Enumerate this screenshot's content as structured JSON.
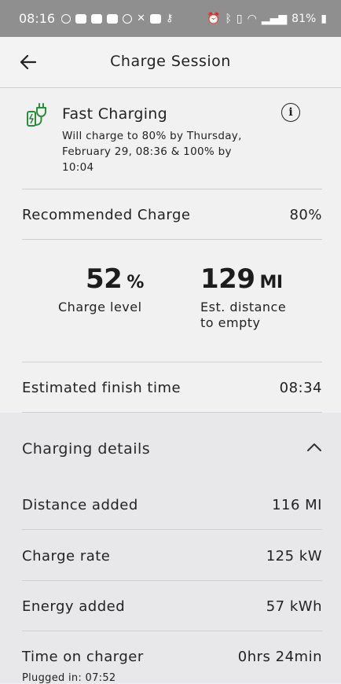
{
  "status_bar": {
    "time": "08:16",
    "battery": "81%"
  },
  "header": {
    "title": "Charge Session"
  },
  "fast_charging": {
    "title": "Fast Charging",
    "description": "Will charge to 80% by Thursday, February 29, 08:36 & 100% by 10:04"
  },
  "recommended": {
    "label": "Recommended Charge",
    "value": "80%"
  },
  "stats": {
    "charge_level": {
      "value": "52",
      "unit": "%",
      "label": "Charge level"
    },
    "distance": {
      "value": "129",
      "unit": "MI",
      "label": "Est. distance to empty"
    }
  },
  "finish_time": {
    "label": "Estimated finish time",
    "value": "08:34"
  },
  "details": {
    "title": "Charging details",
    "rows": [
      {
        "label": "Distance added",
        "value": "116 MI"
      },
      {
        "label": "Charge rate",
        "value": "125 kW"
      },
      {
        "label": "Energy added",
        "value": "57 kWh"
      },
      {
        "label": "Time on charger",
        "value": "0hrs 24min"
      }
    ],
    "plugged_in": "Plugged in: 07:52"
  },
  "colors": {
    "status_bar_bg": "#8f8f8f",
    "page_bg": "#f1f1f1",
    "details_bg": "#e8e8ea",
    "plug_icon_green": "#2e8b3a"
  }
}
